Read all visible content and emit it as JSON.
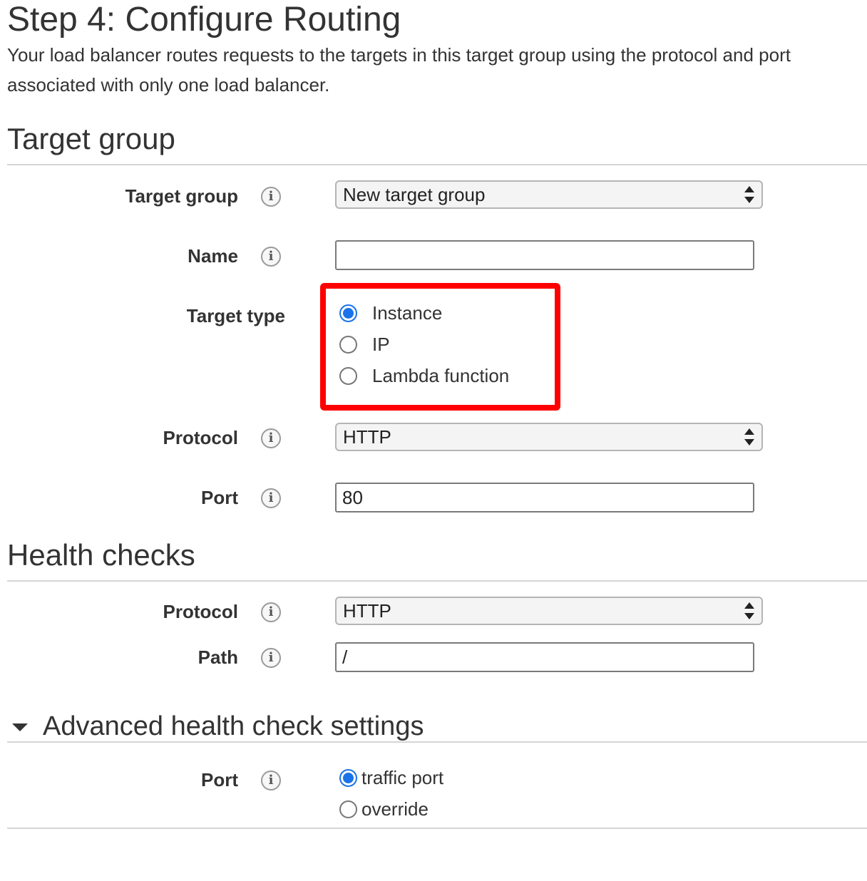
{
  "page": {
    "title": "Step 4: Configure Routing",
    "description": "Your load balancer routes requests to the targets in this target group using the protocol and port associated with only one load balancer."
  },
  "target_group_section": {
    "heading": "Target group",
    "target_group": {
      "label": "Target group",
      "value": "New target group"
    },
    "name": {
      "label": "Name",
      "value": ""
    },
    "target_type": {
      "label": "Target type",
      "options": [
        "Instance",
        "IP",
        "Lambda function"
      ],
      "selected": "Instance"
    },
    "protocol": {
      "label": "Protocol",
      "value": "HTTP"
    },
    "port": {
      "label": "Port",
      "value": "80"
    }
  },
  "health_checks_section": {
    "heading": "Health checks",
    "protocol": {
      "label": "Protocol",
      "value": "HTTP"
    },
    "path": {
      "label": "Path",
      "value": "/"
    }
  },
  "advanced_section": {
    "heading": "Advanced health check settings",
    "port": {
      "label": "Port",
      "options": [
        "traffic port",
        "override"
      ],
      "selected": "traffic port"
    }
  },
  "colors": {
    "accent": "#1a73e8",
    "highlight": "#ff0000",
    "divider": "#d5d5d5"
  },
  "icons": {
    "info": "info-icon",
    "select_arrows": "updown-arrows-icon",
    "expand": "caret-down-icon"
  }
}
